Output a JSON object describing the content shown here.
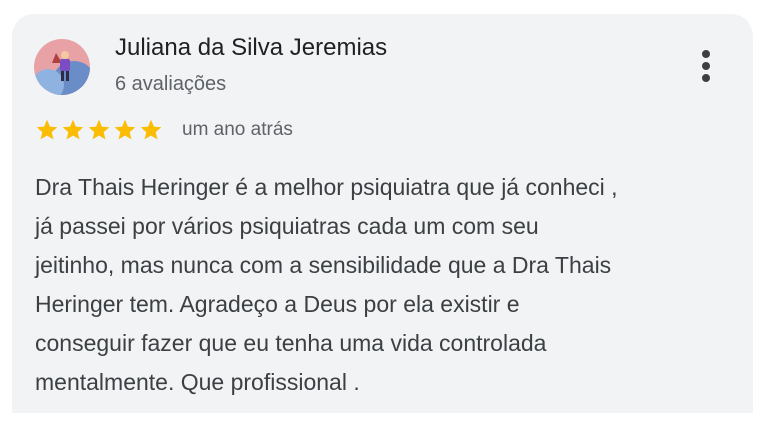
{
  "review": {
    "author_name": "Juliana da Silva Jeremias",
    "reviews_count": "6 avaliações",
    "rating": 5,
    "max_rating": 5,
    "date": "um ano atrás",
    "text_lines": [
      "Dra Thais Heringer é a melhor psiquiatra que já conheci ,",
      "já passei por vários psiquiatras cada um com seu",
      "jeitinho, mas nunca com a sensibilidade que a Dra Thais",
      "Heringer tem. Agradeço a Deus por ela existir e",
      "conseguir fazer que eu tenha uma vida controlada",
      "mentalmente. Que profissional ."
    ]
  },
  "icons": {
    "star": "star-icon",
    "more": "more-vert-icon"
  },
  "colors": {
    "card_background": "#f1f3f5",
    "star": "#fbbc04",
    "text_primary": "#202124",
    "text_secondary": "#5f6368"
  }
}
